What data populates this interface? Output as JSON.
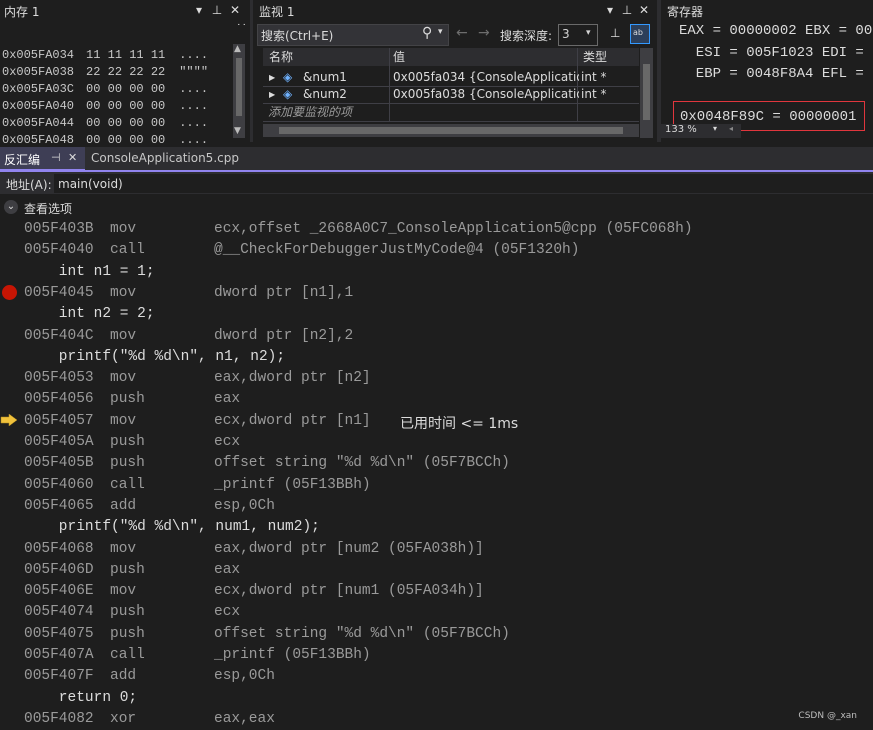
{
  "memory": {
    "title": "内存 1",
    "rows": [
      {
        "addr": "0x005FA034",
        "bytes": "11 11 11 11",
        "chars": "...."
      },
      {
        "addr": "0x005FA038",
        "bytes": "22 22 22 22",
        "chars": "\"\"\"\""
      },
      {
        "addr": "0x005FA03C",
        "bytes": "00 00 00 00",
        "chars": "...."
      },
      {
        "addr": "0x005FA040",
        "bytes": "00 00 00 00",
        "chars": "...."
      },
      {
        "addr": "0x005FA044",
        "bytes": "00 00 00 00",
        "chars": "...."
      },
      {
        "addr": "0x005FA048",
        "bytes": "00 00 00 00",
        "chars": "...."
      }
    ]
  },
  "watch": {
    "title": "监视 1",
    "search_placeholder": "搜索(Ctrl+E)",
    "search_depth_label": "搜索深度:",
    "search_depth_value": "3",
    "columns": {
      "name": "名称",
      "value": "值",
      "type": "类型"
    },
    "rows": [
      {
        "name": "&num1",
        "value": "0x005fa034 {ConsoleApplication...",
        "type": "int *"
      },
      {
        "name": "&num2",
        "value": "0x005fa038 {ConsoleApplication...",
        "type": "int *"
      }
    ],
    "add_item_placeholder": "添加要监视的项"
  },
  "registers": {
    "title": "寄存器",
    "lines": [
      "EAX = 00000002 EBX = 00",
      "  ESI = 005F1023 EDI =",
      "  EBP = 0048F8A4 EFL ="
    ],
    "highlight": "0x0048F89C = 00000001",
    "zoom": "133 %"
  },
  "tabs": {
    "active": "反汇编",
    "file": "ConsoleApplication5.cpp"
  },
  "address_bar": {
    "label": "地址(A):",
    "value": "main(void)"
  },
  "view_options": "查看选项",
  "disasm": [
    {
      "addr": "005F403B",
      "op": "mov",
      "args": "ecx,offset _2668A0C7_ConsoleApplication5@cpp (05FC068h)"
    },
    {
      "addr": "005F4040",
      "op": "call",
      "args": "@__CheckForDebuggerJustMyCode@4 (05F1320h)"
    },
    {
      "src": "    int n1 = 1;"
    },
    {
      "addr": "005F4045",
      "op": "mov",
      "args": "dword ptr [n1],1"
    },
    {
      "src": "    int n2 = 2;"
    },
    {
      "addr": "005F404C",
      "op": "mov",
      "args": "dword ptr [n2],2"
    },
    {
      "src": "    printf(\"%d %d\\n\", n1, n2);"
    },
    {
      "addr": "005F4053",
      "op": "mov",
      "args": "eax,dword ptr [n2]"
    },
    {
      "addr": "005F4056",
      "op": "push",
      "args": "eax"
    },
    {
      "addr": "005F4057",
      "op": "mov",
      "args": "ecx,dword ptr [n1]"
    },
    {
      "addr": "005F405A",
      "op": "push",
      "args": "ecx"
    },
    {
      "addr": "005F405B",
      "op": "push",
      "args": "offset string \"%d %d\\n\" (05F7BCCh)"
    },
    {
      "addr": "005F4060",
      "op": "call",
      "args": "_printf (05F13BBh)"
    },
    {
      "addr": "005F4065",
      "op": "add",
      "args": "esp,0Ch"
    },
    {
      "src": "    printf(\"%d %d\\n\", num1, num2);"
    },
    {
      "addr": "005F4068",
      "op": "mov",
      "args": "eax,dword ptr [num2 (05FA038h)]"
    },
    {
      "addr": "005F406D",
      "op": "push",
      "args": "eax"
    },
    {
      "addr": "005F406E",
      "op": "mov",
      "args": "ecx,dword ptr [num1 (05FA034h)]"
    },
    {
      "addr": "005F4074",
      "op": "push",
      "args": "ecx"
    },
    {
      "addr": "005F4075",
      "op": "push",
      "args": "offset string \"%d %d\\n\" (05F7BCCh)"
    },
    {
      "addr": "005F407A",
      "op": "call",
      "args": "_printf (05F13BBh)"
    },
    {
      "addr": "005F407F",
      "op": "add",
      "args": "esp,0Ch"
    },
    {
      "src": "    return 0;"
    },
    {
      "addr": "005F4082",
      "op": "xor",
      "args": "eax,eax"
    }
  ],
  "elapsed_note": "已用时间 <= 1ms",
  "watermark": "CSDN @_xan",
  "colors": {
    "breakpoint": "#e51400",
    "current_arrow": "#f0c13c",
    "highlight_box": "#e0363d",
    "tab_accent": "#9184ee"
  }
}
